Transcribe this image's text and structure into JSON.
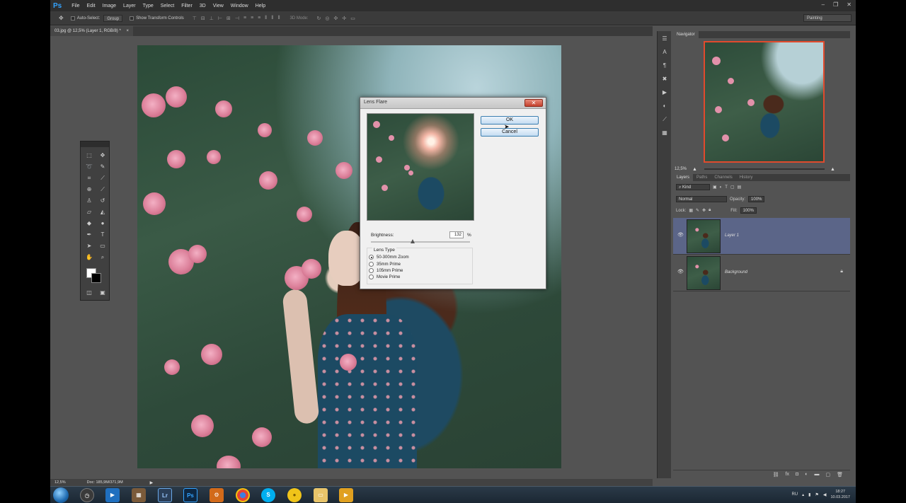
{
  "app": {
    "logo": "Ps",
    "menu": [
      "File",
      "Edit",
      "Image",
      "Layer",
      "Type",
      "Select",
      "Filter",
      "3D",
      "View",
      "Window",
      "Help"
    ],
    "window_controls": [
      "–",
      "❐",
      "✕"
    ]
  },
  "options_bar": {
    "auto_select_label": "Auto-Select:",
    "auto_select_value": "Group",
    "transform_label": "Show Transform Controls",
    "mode_3d_label": "3D Mode:",
    "workspace": "Painting"
  },
  "document": {
    "tab_title": "03.jpg @ 12,5% (Layer 1, RGB/8) *",
    "tab_close": "×"
  },
  "dialog": {
    "title": "Lens Flare",
    "ok_label": "OK",
    "cancel_label": "Cancel",
    "brightness_label": "Brightness:",
    "brightness_value": "132",
    "brightness_unit": "%",
    "brightness_pct": 132,
    "lens_type_label": "Lens Type",
    "lens_types": [
      "50-300mm Zoom",
      "35mm Prime",
      "105mm Prime",
      "Movie Prime"
    ],
    "selected_lens": "50-300mm Zoom"
  },
  "navigator": {
    "tab": "Navigator",
    "zoom": "12,5%"
  },
  "layers": {
    "tabs": [
      "Layers",
      "Paths",
      "Channels",
      "History"
    ],
    "kind_filter": "Kind",
    "blend_mode": "Normal",
    "opacity_label": "Opacity:",
    "opacity_value": "100%",
    "lock_label": "Lock:",
    "fill_label": "Fill:",
    "fill_value": "100%",
    "items": [
      {
        "name": "Layer 1",
        "selected": true
      },
      {
        "name": "Background",
        "selected": false
      }
    ]
  },
  "status": {
    "zoom": "12,5%",
    "doc": "Doc: 185,9M/371,9M"
  },
  "taskbar": {
    "apps": [
      "chrome-icon-generic",
      "Lr",
      "Ps"
    ],
    "language": "RU",
    "time": "18:27",
    "date": "10.03.2017"
  },
  "colors": {
    "selection_blue": "#5b6588",
    "navigator_frame": "#e14a2d",
    "ps_blue": "#33a3ff"
  }
}
